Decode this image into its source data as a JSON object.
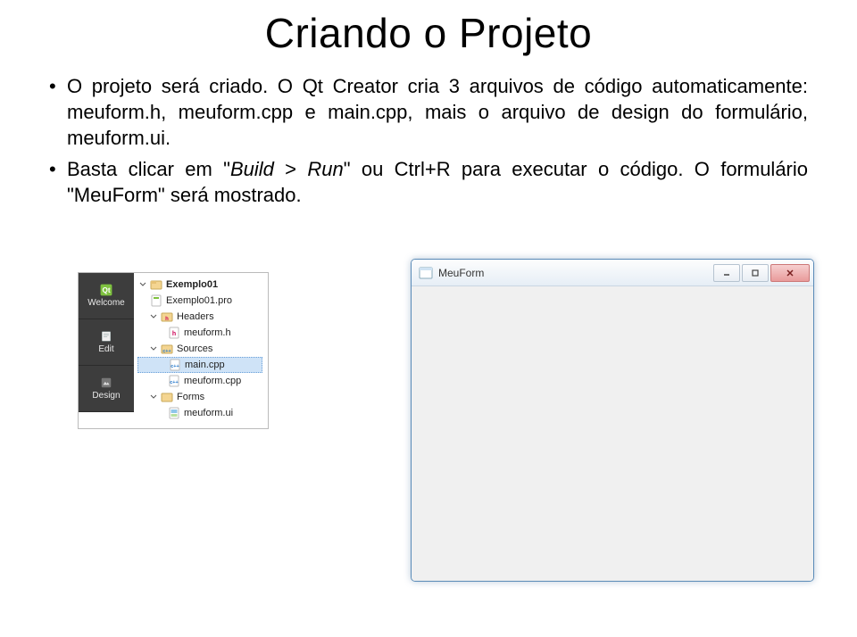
{
  "title": "Criando o Projeto",
  "bullets": {
    "b1a": "O projeto será criado. O Qt Creator cria 3 arquivos de código automaticamente: meuform.h, meuform.cpp e main.cpp, mais o arquivo de design do formulário, meuform.ui.",
    "b2a": "Basta clicar em \"",
    "b2_build": "Build",
    "b2b": " > ",
    "b2_run": "Run",
    "b2c": "\" ou Ctrl+R para executar o código. O formulário \"MeuForm\" será mostrado."
  },
  "ide": {
    "modes": {
      "welcome": "Welcome",
      "edit": "Edit",
      "design": "Design"
    },
    "tree": {
      "project": "Exemplo01",
      "profile": "Exemplo01.pro",
      "headers": "Headers",
      "header_file": "meuform.h",
      "sources": "Sources",
      "main_cpp": "main.cpp",
      "meuform_cpp": "meuform.cpp",
      "forms": "Forms",
      "ui_file": "meuform.ui"
    }
  },
  "window": {
    "title": "MeuForm"
  }
}
